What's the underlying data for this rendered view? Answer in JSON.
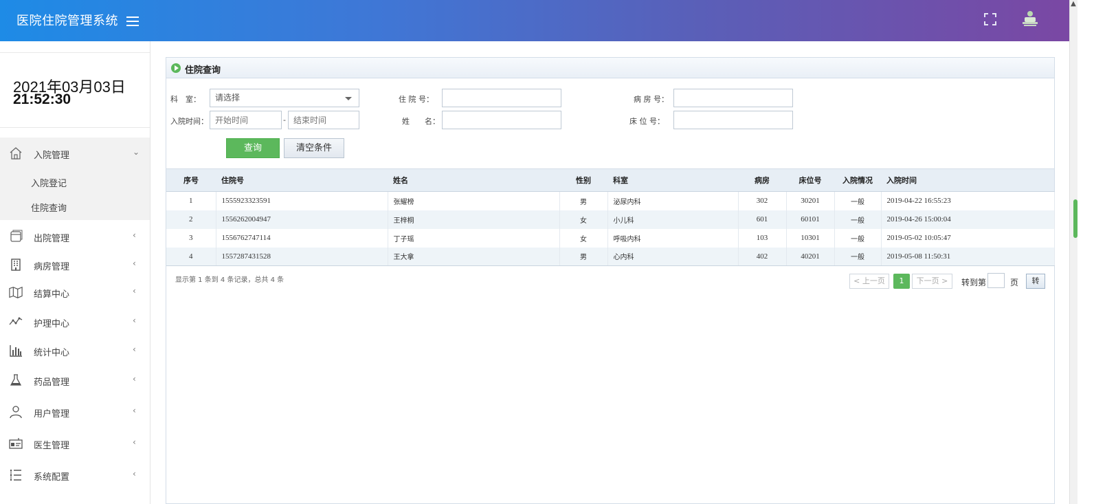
{
  "header": {
    "title": "医院住院管理系统"
  },
  "sidebar": {
    "date": "2021年03月03日",
    "time": "21:52:30",
    "menus": [
      {
        "label": "入院管理",
        "icon": "home-icon",
        "arrow": "⌄"
      },
      {
        "label": "出院管理",
        "icon": "document-icon",
        "arrow": "‹"
      },
      {
        "label": "病房管理",
        "icon": "building-icon",
        "arrow": "‹"
      },
      {
        "label": "结算中心",
        "icon": "map-icon",
        "arrow": "‹"
      },
      {
        "label": "护理中心",
        "icon": "activity-icon",
        "arrow": "‹"
      },
      {
        "label": "统计中心",
        "icon": "bar-chart-icon",
        "arrow": "‹"
      },
      {
        "label": "药品管理",
        "icon": "flask-icon",
        "arrow": "‹"
      },
      {
        "label": "用户管理",
        "icon": "user-icon",
        "arrow": "‹"
      },
      {
        "label": "医生管理",
        "icon": "id-card-icon",
        "arrow": "‹"
      },
      {
        "label": "系统配置",
        "icon": "list-icon",
        "arrow": "‹"
      }
    ],
    "submenu": [
      {
        "label": "入院登记"
      },
      {
        "label": "住院查询"
      }
    ]
  },
  "panel": {
    "title": "住院查询",
    "form": {
      "dept_label": "科　室：",
      "dept_value": "请选择",
      "admit_no_label": "住 院 号：",
      "ward_no_label": "病 房 号：",
      "admit_time_label": "入院时间：",
      "start_placeholder": "开始时间",
      "dash": "-",
      "end_placeholder": "结束时间",
      "name_label": "姓　　名：",
      "bed_no_label": "床 位 号：",
      "query_button": "查询",
      "clear_button": "清空条件"
    },
    "table": {
      "columns": [
        "序号",
        "住院号",
        "姓名",
        "性别",
        "科室",
        "病房",
        "床位号",
        "入院情况",
        "入院时间"
      ],
      "rows": [
        [
          "1",
          "1555923323591",
          "张耀榜",
          "男",
          "泌尿内科",
          "302",
          "30201",
          "一般",
          "2019-04-22 16:55:23"
        ],
        [
          "2",
          "1556262004947",
          "王梓桐",
          "女",
          "小儿科",
          "601",
          "60101",
          "一般",
          "2019-04-26 15:00:04"
        ],
        [
          "3",
          "1556762747114",
          "丁子瑶",
          "女",
          "呼吸内科",
          "103",
          "10301",
          "一般",
          "2019-05-02 10:05:47"
        ],
        [
          "4",
          "1557287431528",
          "王大拿",
          "男",
          "心内科",
          "402",
          "40201",
          "一般",
          "2019-05-08 11:50:31"
        ]
      ]
    },
    "footer": {
      "info": "显示第 1 条到 4 条记录，总共 4 条",
      "prev": "< 上一页",
      "current_page": "1",
      "next": "下一页 >",
      "goto_label": "转到第",
      "page_unit": "页",
      "go_button": "转"
    }
  },
  "colors": {
    "accent_green": "#5cb85c",
    "header_start": "#1e8be6",
    "header_end": "#7b47a3"
  }
}
